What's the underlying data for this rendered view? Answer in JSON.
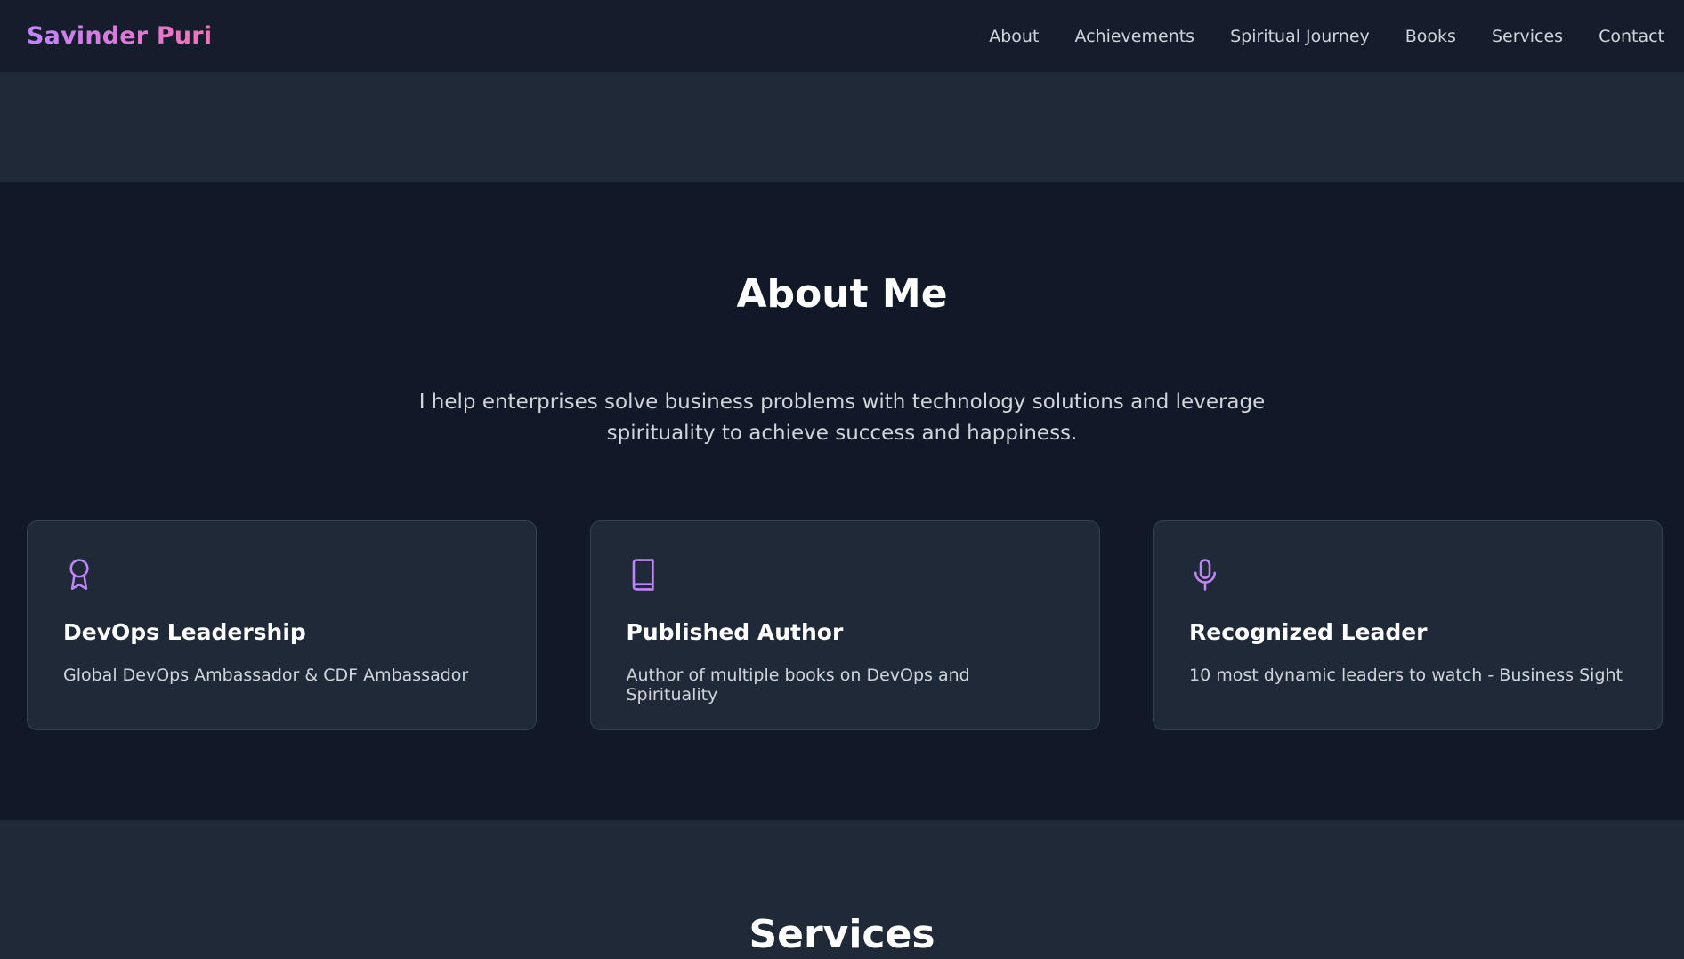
{
  "header": {
    "brand": "Savinder Puri",
    "nav": [
      {
        "label": "About"
      },
      {
        "label": "Achievements"
      },
      {
        "label": "Spiritual Journey"
      },
      {
        "label": "Books"
      },
      {
        "label": "Services"
      },
      {
        "label": "Contact"
      }
    ]
  },
  "about": {
    "title": "About Me",
    "intro": "I help enterprises solve business problems with technology solutions and leverage spirituality to achieve success and happiness.",
    "cards": [
      {
        "icon": "award-ribbon-icon",
        "title": "DevOps Leadership",
        "description": "Global DevOps Ambassador & CDF Ambassador"
      },
      {
        "icon": "book-icon",
        "title": "Published Author",
        "description": "Author of multiple books on DevOps and Spirituality"
      },
      {
        "icon": "microphone-icon",
        "title": "Recognized Leader",
        "description": "10 most dynamic leaders to watch - Business Sight"
      }
    ]
  },
  "services": {
    "title": "Services"
  },
  "colors": {
    "page_background": "#111827",
    "header_background": "#151c2b",
    "section_alt_background": "#1f2937",
    "card_border": "#374151",
    "accent_purple": "#c084fc",
    "accent_pink": "#f472b6",
    "body_text": "#d1d5db"
  }
}
